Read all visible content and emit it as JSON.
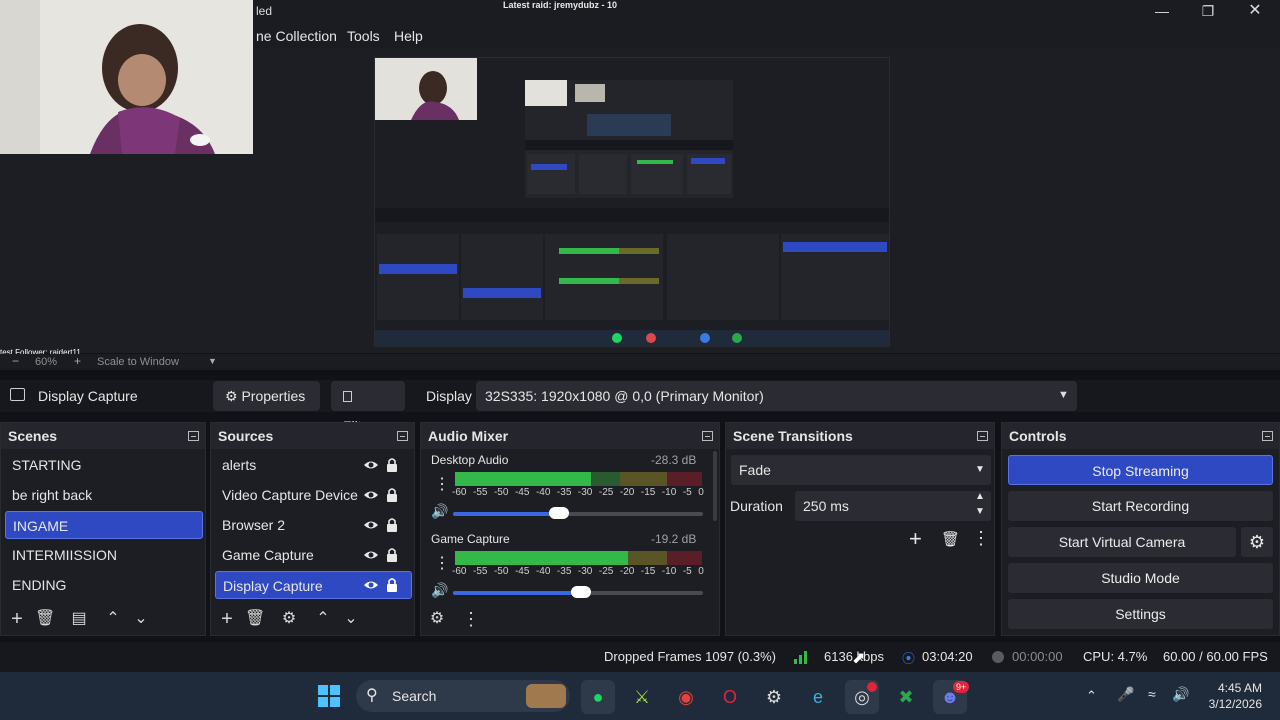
{
  "window": {
    "title": "Latest raid: jremydubz - 10",
    "title_fragment": "led",
    "minimize_icon": "minimize-icon",
    "maximize_icon": "restore-icon",
    "close_icon": "close-icon"
  },
  "menu": {
    "items": [
      "ne Collection",
      "Tools",
      "Help"
    ]
  },
  "overlay": {
    "follower_text": "test Follower: raidert11"
  },
  "zoom": {
    "minus": "−",
    "level": "60%",
    "plus": "+",
    "mode": "Scale to Window"
  },
  "source_toolbar": {
    "current_source": "Display Capture",
    "properties_label": "Properties",
    "filters_label": "Filters",
    "display_label": "Display",
    "display_value": "32S335: 1920x1080 @ 0,0 (Primary Monitor)"
  },
  "scenes": {
    "title": "Scenes",
    "items": [
      "STARTING",
      "be right back",
      "INGAME",
      "INTERMIISSION",
      "ENDING"
    ],
    "active_index": 2
  },
  "sources": {
    "title": "Sources",
    "items": [
      "alerts",
      "Video Capture Device",
      "Browser 2",
      "Game Capture",
      "Display Capture"
    ],
    "active_index": 4
  },
  "audio_mixer": {
    "title": "Audio Mixer",
    "channels": [
      {
        "name": "Desktop Audio",
        "db": "-28.3 dB",
        "level": 0.55,
        "volume": 0.39
      },
      {
        "name": "Game Capture",
        "db": "-19.2 dB",
        "level": 0.7,
        "volume": 0.48
      }
    ],
    "scale": [
      "-60",
      "-55",
      "-50",
      "-45",
      "-40",
      "-35",
      "-30",
      "-25",
      "-20",
      "-15",
      "-10",
      "-5",
      "0"
    ]
  },
  "scene_transitions": {
    "title": "Scene Transitions",
    "transition": "Fade",
    "duration_label": "Duration",
    "duration_value": "250 ms"
  },
  "controls": {
    "title": "Controls",
    "stop_streaming": "Stop Streaming",
    "start_recording": "Start Recording",
    "start_virtual_camera": "Start Virtual Camera",
    "studio_mode": "Studio Mode",
    "settings": "Settings"
  },
  "status": {
    "dropped_frames": "Dropped Frames 1097 (0.3%)",
    "bitrate": "6136 kbps",
    "stream_time": "03:04:20",
    "record_time": "00:00:00",
    "cpu": "CPU: 4.7%",
    "fps": "60.00 / 60.00 FPS"
  },
  "taskbar": {
    "search_label": "Search",
    "time": "4:45 AM",
    "date": "3/12/2026",
    "badge": "9+"
  },
  "colors": {
    "accent": "#2f49c2",
    "meter_green": "#33b84a",
    "meter_yellow": "#b7a23a",
    "meter_red": "#b2263a"
  }
}
